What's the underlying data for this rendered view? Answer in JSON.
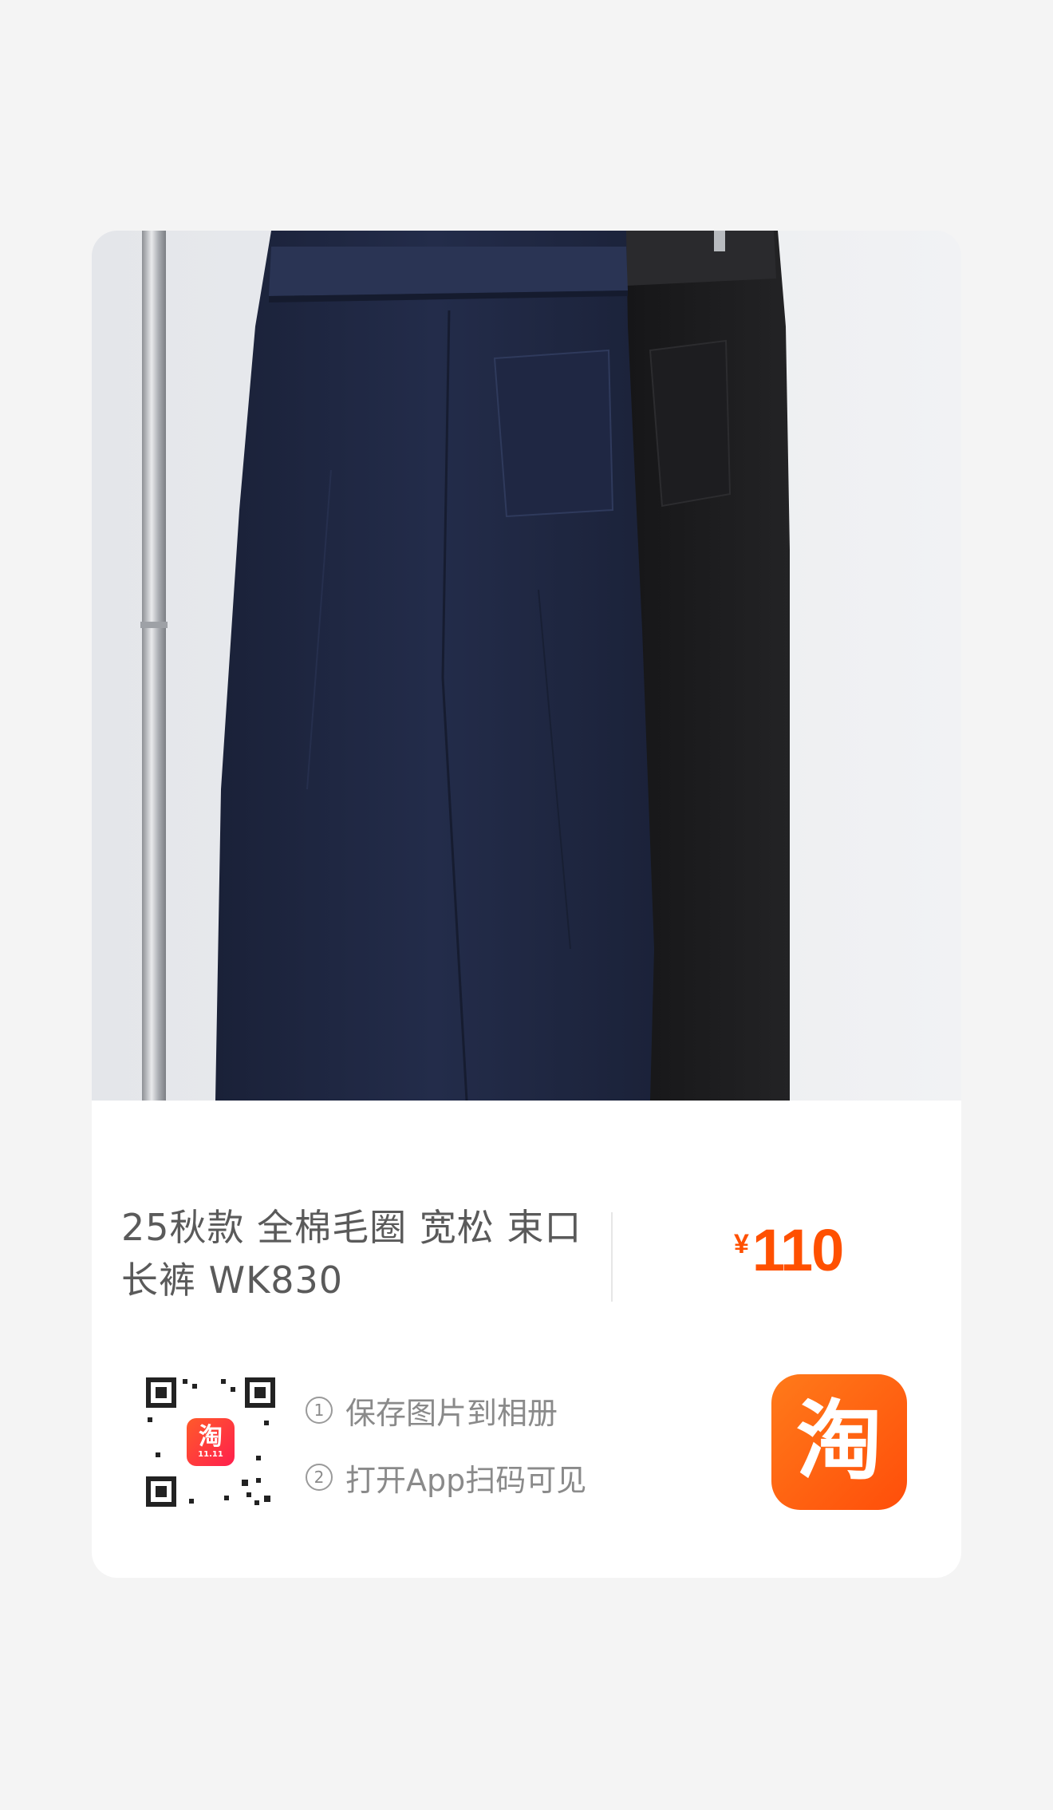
{
  "product": {
    "title": "25秋款 全棉毛圈 宽松 束口长裤 WK830",
    "currency": "¥",
    "price": "110"
  },
  "share": {
    "qr_badge": "淘",
    "qr_badge_sub": "11.11",
    "step1_num": "1",
    "step1": "保存图片到相册",
    "step2_num": "2",
    "step2": "打开App扫码可见",
    "app_icon_glyph": "淘"
  },
  "colors": {
    "accent": "#ff5000",
    "navy_pants": "#1d2540",
    "black_pants": "#1a1a1c"
  }
}
